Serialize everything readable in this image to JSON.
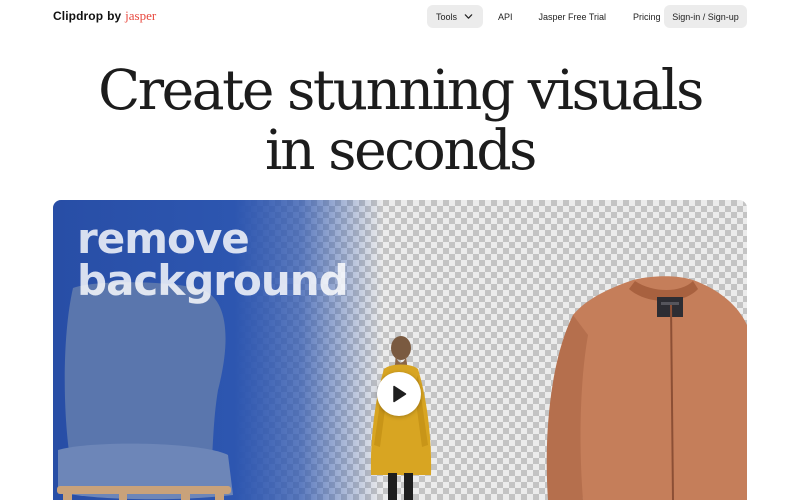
{
  "header": {
    "logo": {
      "main": "Clipdrop",
      "by": "by",
      "brand": "jasper"
    },
    "nav": {
      "tools_label": "Tools",
      "api_label": "API",
      "trial_label": "Jasper Free Trial",
      "pricing_label": "Pricing",
      "signin_label": "Sign-in / Sign-up"
    }
  },
  "hero": {
    "title_line1": "Create stunning visuals",
    "title_line2": "in seconds"
  },
  "video": {
    "overlay_line1": "remove",
    "overlay_line2": "background",
    "play_icon": "play-icon"
  },
  "colors": {
    "brand_red": "#e8493f",
    "pill_bg": "#ececec",
    "blue_panel": "#2d56b0"
  }
}
